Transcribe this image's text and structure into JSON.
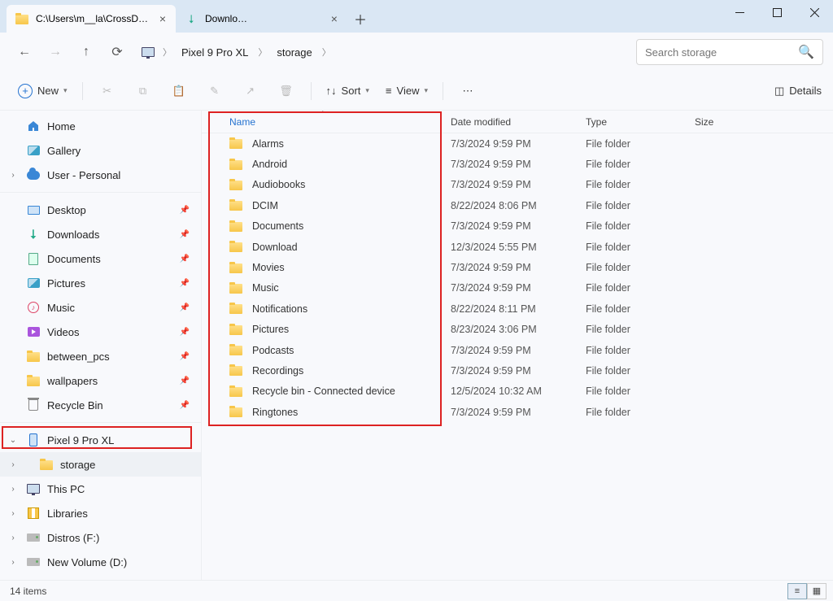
{
  "tabs": [
    {
      "title": "C:\\Users\\m__la\\CrossDevice\\Pi",
      "icon": "folder"
    },
    {
      "title": "Downloads",
      "icon": "download"
    }
  ],
  "nav": {
    "breadcrumbs": [
      "Pixel 9 Pro XL",
      "storage"
    ]
  },
  "search": {
    "placeholder": "Search storage"
  },
  "toolbar": {
    "new_label": "New",
    "sort_label": "Sort",
    "view_label": "View",
    "details_label": "Details"
  },
  "columns": {
    "name": "Name",
    "date": "Date modified",
    "type": "Type",
    "size": "Size"
  },
  "files": [
    {
      "name": "Alarms",
      "date": "7/3/2024 9:59 PM",
      "type": "File folder"
    },
    {
      "name": "Android",
      "date": "7/3/2024 9:59 PM",
      "type": "File folder"
    },
    {
      "name": "Audiobooks",
      "date": "7/3/2024 9:59 PM",
      "type": "File folder"
    },
    {
      "name": "DCIM",
      "date": "8/22/2024 8:06 PM",
      "type": "File folder"
    },
    {
      "name": "Documents",
      "date": "7/3/2024 9:59 PM",
      "type": "File folder"
    },
    {
      "name": "Download",
      "date": "12/3/2024 5:55 PM",
      "type": "File folder"
    },
    {
      "name": "Movies",
      "date": "7/3/2024 9:59 PM",
      "type": "File folder"
    },
    {
      "name": "Music",
      "date": "7/3/2024 9:59 PM",
      "type": "File folder"
    },
    {
      "name": "Notifications",
      "date": "8/22/2024 8:11 PM",
      "type": "File folder"
    },
    {
      "name": "Pictures",
      "date": "8/23/2024 3:06 PM",
      "type": "File folder"
    },
    {
      "name": "Podcasts",
      "date": "7/3/2024 9:59 PM",
      "type": "File folder"
    },
    {
      "name": "Recordings",
      "date": "7/3/2024 9:59 PM",
      "type": "File folder"
    },
    {
      "name": "Recycle bin - Connected device",
      "date": "12/5/2024 10:32 AM",
      "type": "File folder"
    },
    {
      "name": "Ringtones",
      "date": "7/3/2024 9:59 PM",
      "type": "File folder"
    }
  ],
  "sidebar": {
    "top": [
      {
        "label": "Home",
        "icon": "home"
      },
      {
        "label": "Gallery",
        "icon": "gallery"
      },
      {
        "label": "User - Personal",
        "icon": "cloud",
        "expander": "right"
      }
    ],
    "quick": [
      {
        "label": "Desktop",
        "icon": "desktop",
        "pinned": true
      },
      {
        "label": "Downloads",
        "icon": "downloads",
        "pinned": true
      },
      {
        "label": "Documents",
        "icon": "documents",
        "pinned": true
      },
      {
        "label": "Pictures",
        "icon": "pictures",
        "pinned": true
      },
      {
        "label": "Music",
        "icon": "music",
        "pinned": true
      },
      {
        "label": "Videos",
        "icon": "videos",
        "pinned": true
      },
      {
        "label": "between_pcs",
        "icon": "folder",
        "pinned": true
      },
      {
        "label": "wallpapers",
        "icon": "folder",
        "pinned": true
      },
      {
        "label": "Recycle Bin",
        "icon": "trash",
        "pinned": true
      }
    ],
    "bottom": [
      {
        "label": "Pixel 9 Pro XL",
        "icon": "phone",
        "expander": "down",
        "highlighted": true
      },
      {
        "label": "storage",
        "icon": "folder",
        "sub": true,
        "expander": "right",
        "selected": true
      },
      {
        "label": "This PC",
        "icon": "monitor",
        "expander": "right"
      },
      {
        "label": "Libraries",
        "icon": "libraries",
        "expander": "right"
      },
      {
        "label": "Distros (F:)",
        "icon": "drive",
        "expander": "right"
      },
      {
        "label": "New Volume (D:)",
        "icon": "drive",
        "expander": "right"
      }
    ]
  },
  "status": {
    "count": "14 items"
  }
}
